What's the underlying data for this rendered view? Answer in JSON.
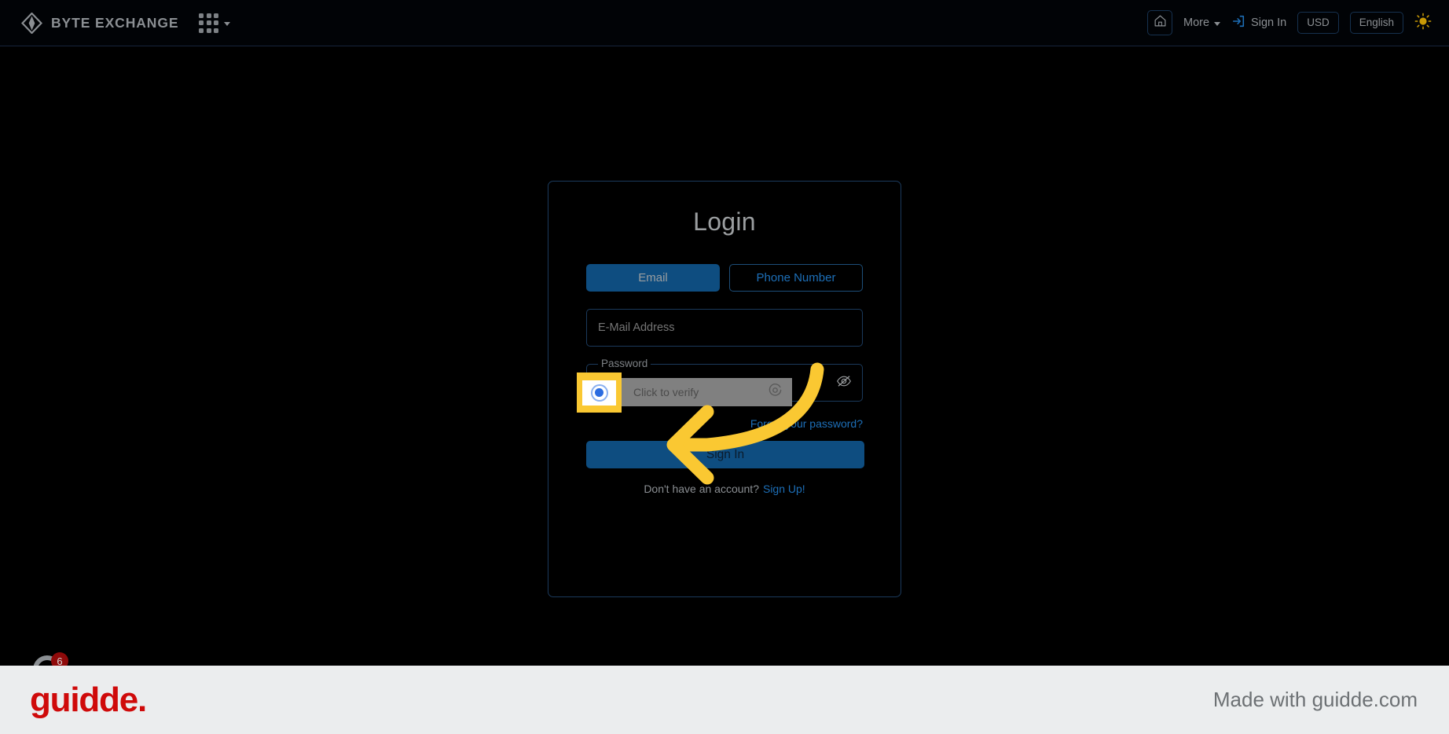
{
  "header": {
    "brand_name": "BYTE EXCHANGE",
    "brand_logo_icon": "byte-exchange-diamond-logo",
    "apps_icon": "apps-grid-icon",
    "apps_chevron_icon": "chevron-down-icon",
    "home_icon": "home-icon",
    "more_label": "More",
    "more_chevron_icon": "chevron-down-icon",
    "signin_icon": "sign-in-arrow-icon",
    "signin_label": "Sign In",
    "currency_label": "USD",
    "language_label": "English",
    "theme_icon": "sun-icon"
  },
  "login": {
    "title": "Login",
    "tabs": [
      {
        "label": "Email",
        "active": true
      },
      {
        "label": "Phone Number",
        "active": false
      }
    ],
    "email_field": {
      "placeholder": "E-Mail Address",
      "value": ""
    },
    "password_field": {
      "label": "Password",
      "value": "",
      "toggle_icon": "eye-slash-icon"
    },
    "captcha": {
      "text": "Click to verify",
      "checkbox_icon": "radio-checked-icon",
      "refresh_icon": "refresh-icon",
      "highlighted": true
    },
    "forgot_password": "Forgot your password?",
    "submit_label": "Sign In",
    "signup_prompt": "Don't have an account?",
    "signup_link": "Sign Up!"
  },
  "annotation": {
    "arrow_icon": "curved-arrow-pointing-left",
    "arrow_color": "#fac832",
    "highlight_color": "#fac832"
  },
  "floating_badge": {
    "count": "6",
    "icon": "notification-circle-icon"
  },
  "footer": {
    "logo_text": "guidde.",
    "credit_text": "Made with guidde.com"
  },
  "colors": {
    "page_background": "#000000",
    "header_background": "#010306",
    "card_border": "#1b3a5c",
    "accent_blue": "#0e4d80",
    "link_blue": "#1d6fb8",
    "footer_background": "#ebedee",
    "brand_red": "#cf0a0a",
    "annotation_yellow": "#fac832"
  }
}
